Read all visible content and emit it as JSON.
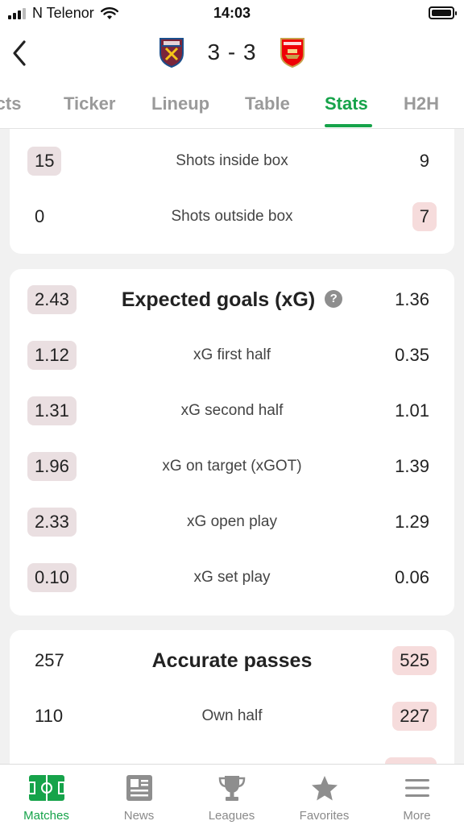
{
  "status_bar": {
    "carrier": "N Telenor",
    "time": "14:03"
  },
  "header": {
    "score": "3 - 3",
    "home_crest": "west-ham-crest",
    "away_crest": "arsenal-crest",
    "back_icon": "chevron-left-icon"
  },
  "tabs": [
    {
      "label": "Facts"
    },
    {
      "label": "Ticker"
    },
    {
      "label": "Lineup"
    },
    {
      "label": "Table"
    },
    {
      "label": "Stats"
    },
    {
      "label": "H2H"
    }
  ],
  "active_tab": "Stats",
  "shots_card": {
    "rows": [
      {
        "home": "15",
        "label": "Shots inside box",
        "away": "9",
        "highlight": "home"
      },
      {
        "home": "0",
        "label": "Shots outside box",
        "away": "7",
        "highlight": "away"
      }
    ]
  },
  "xg_card": {
    "header": {
      "home": "2.43",
      "title": "Expected goals (xG)",
      "away": "1.36",
      "help_icon": "question-icon"
    },
    "rows": [
      {
        "home": "1.12",
        "label": "xG first half",
        "away": "0.35"
      },
      {
        "home": "1.31",
        "label": "xG second half",
        "away": "1.01"
      },
      {
        "home": "1.96",
        "label": "xG on target (xGOT)",
        "away": "1.39"
      },
      {
        "home": "2.33",
        "label": "xG open play",
        "away": "1.29"
      },
      {
        "home": "0.10",
        "label": "xG set play",
        "away": "0.06"
      }
    ]
  },
  "passes_card": {
    "header": {
      "home": "257",
      "title": "Accurate passes",
      "away": "525"
    },
    "rows": [
      {
        "home": "110",
        "label": "Own half",
        "away": "227"
      }
    ]
  },
  "bottom_nav": [
    {
      "label": "Matches",
      "icon": "pitch-icon"
    },
    {
      "label": "News",
      "icon": "newspaper-icon"
    },
    {
      "label": "Leagues",
      "icon": "trophy-icon"
    },
    {
      "label": "Favorites",
      "icon": "star-icon"
    },
    {
      "label": "More",
      "icon": "menu-icon"
    }
  ],
  "colors": {
    "accent": "#16a34a",
    "home_highlight": "#eadfe1",
    "away_highlight": "#f6dcdc"
  }
}
